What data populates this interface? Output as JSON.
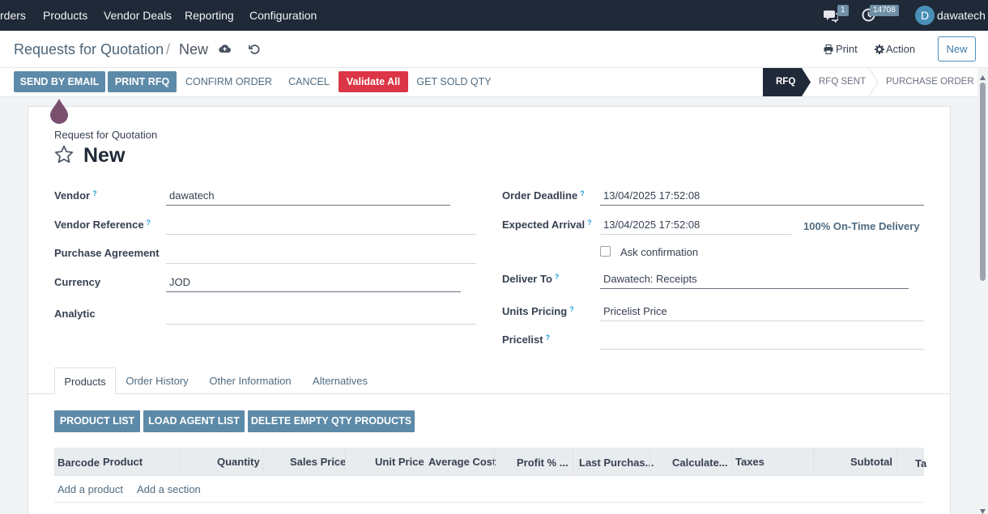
{
  "navbar": {
    "items": [
      "rders",
      "Products",
      "Vendor Deals",
      "Reporting",
      "Configuration"
    ],
    "messages_count": "1",
    "activities_count": "14708",
    "user_initial": "D",
    "user_name": "dawatech"
  },
  "control": {
    "breadcrumb_parent": "Requests for Quotation",
    "breadcrumb_sep": "/",
    "breadcrumb_current": "New",
    "print_label": "Print",
    "action_label": "Action",
    "new_label": "New"
  },
  "actions": {
    "send_by_email": "SEND BY EMAIL",
    "print_rfq": "PRINT RFQ",
    "confirm_order": "CONFIRM ORDER",
    "cancel": "CANCEL",
    "validate_all": "Validate All",
    "get_sold_qty": "GET SOLD QTY"
  },
  "statusbar": {
    "stages": [
      "RFQ",
      "RFQ SENT",
      "PURCHASE ORDER"
    ],
    "active": "RFQ"
  },
  "form": {
    "subtitle": "Request for Quotation",
    "title": "New",
    "left": {
      "vendor_label": "Vendor",
      "vendor_value": "dawatech",
      "vendor_reference_label": "Vendor Reference",
      "vendor_reference_value": "",
      "purchase_agreement_label": "Purchase Agreement",
      "purchase_agreement_value": "",
      "currency_label": "Currency",
      "currency_value": "JOD",
      "analytic_label": "Analytic",
      "analytic_value": ""
    },
    "right": {
      "order_deadline_label": "Order Deadline",
      "order_deadline_value": "13/04/2025 17:52:08",
      "expected_arrival_label": "Expected Arrival",
      "expected_arrival_value": "13/04/2025 17:52:08",
      "on_time_delivery": "100% On-Time Delivery",
      "ask_confirmation_label": "Ask confirmation",
      "deliver_to_label": "Deliver To",
      "deliver_to_value": "Dawatech: Receipts",
      "units_pricing_label": "Units Pricing",
      "units_pricing_value": "Pricelist Price",
      "pricelist_label": "Pricelist",
      "pricelist_value": ""
    },
    "help_marker": "?"
  },
  "tabs": [
    "Products",
    "Order History",
    "Other Information",
    "Alternatives"
  ],
  "list_buttons": [
    "PRODUCT LIST",
    "LOAD AGENT LIST",
    "DELETE EMPTY QTY PRODUCTS"
  ],
  "table": {
    "columns": [
      "Barcode",
      "Product",
      "Quantity",
      "Sales Price",
      "Unit Price",
      "Average Cost",
      "Profit % ...",
      "Last Purchas...",
      "Calculate...",
      "Taxes",
      "Subtotal",
      "Ta"
    ],
    "add_product": "Add a product",
    "add_section": "Add a section"
  },
  "colors": {
    "navbar": "#1f2937",
    "primary": "#5d8aa8",
    "danger": "#dc3545",
    "stage_active": "#1f2937",
    "help": "#1f9cd6"
  }
}
